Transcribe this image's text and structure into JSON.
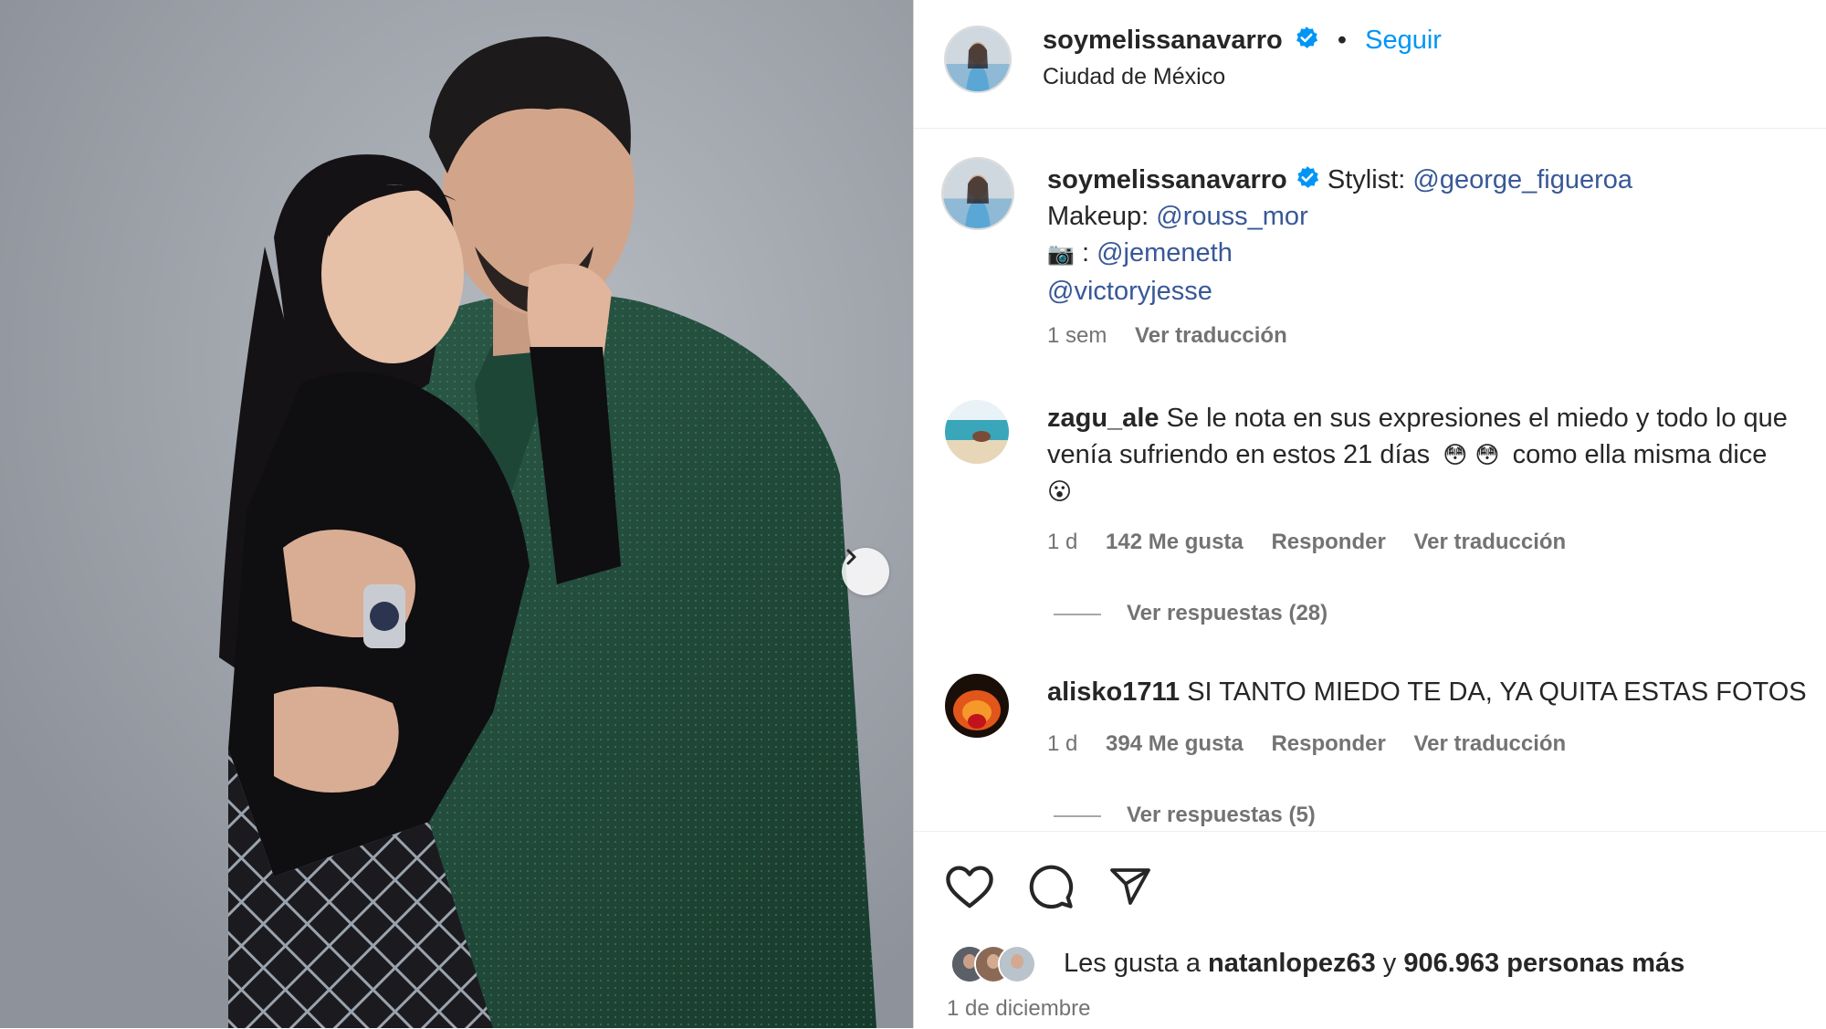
{
  "post": {
    "username": "soymelissanavarro",
    "follow_label": "Seguir",
    "separator": "•",
    "location": "Ciudad de México"
  },
  "caption": {
    "username": "soymelissanavarro",
    "line1_prefix": "Stylist:",
    "stylist_handle": "@george_figueroa",
    "line2_prefix": "Makeup:",
    "makeup_handle": "@rouss_mor",
    "camera_emoji": "📷",
    "line3_sep": ":",
    "photo_handle": "@jemeneth",
    "extra_handle": "@victoryjesse",
    "time": "1 sem",
    "translate": "Ver traducción"
  },
  "comments": [
    {
      "username": "zagu_ale",
      "text_line1": "Se le nota en sus expresiones el miedo y todo lo que",
      "text_line2": "venía sufriendo en estos 21 días",
      "emoji1": "😳",
      "emoji2": "😳",
      "text_line2_end": "como ella misma dice",
      "emoji3": "😮",
      "time": "1 d",
      "likes": "142 Me gusta",
      "reply": "Responder",
      "translate": "Ver traducción",
      "view_replies": "Ver respuestas (28)"
    },
    {
      "username": "alisko1711",
      "text": "SI TANTO MIEDO TE DA, YA QUITA ESTAS FOTOS",
      "time": "1 d",
      "likes": "394 Me gusta",
      "reply": "Responder",
      "translate": "Ver traducción",
      "view_replies": "Ver respuestas (5)"
    }
  ],
  "actions": {
    "like_icon": "heart-icon",
    "comment_icon": "comment-icon",
    "share_icon": "send-icon",
    "likes_prefix": "Les gusta a",
    "likes_user": "natanlopez63",
    "likes_join": "y",
    "likes_others": "906.963 personas más",
    "date": "1 de diciembre"
  },
  "colors": {
    "verified": "#0095f6",
    "follow": "#0095f6",
    "mention": "#385898",
    "muted": "#737373"
  }
}
